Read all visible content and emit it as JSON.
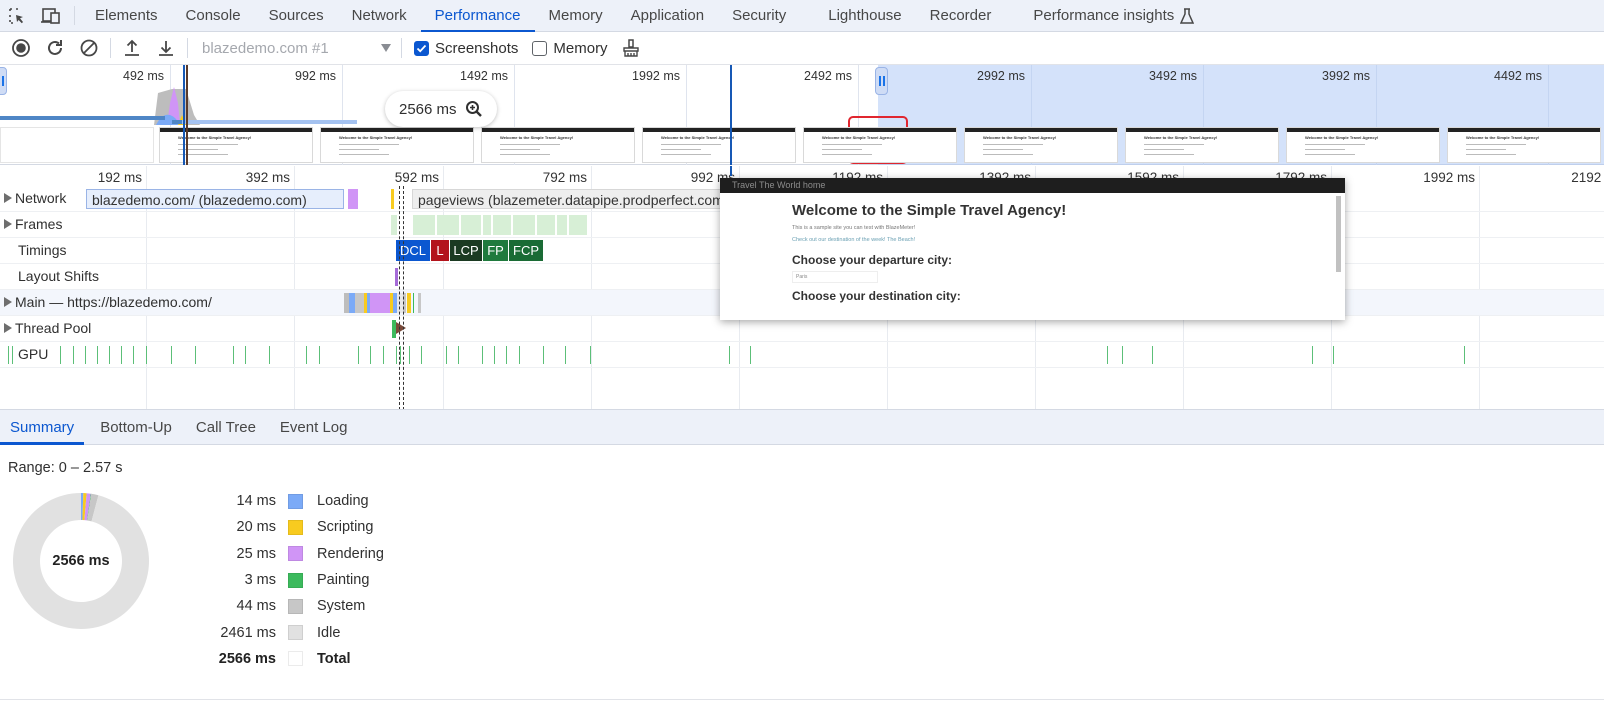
{
  "tabbar": {
    "tools": [
      "inspect-element-icon",
      "device-toolbar-icon"
    ],
    "tabs": [
      {
        "label": "Elements",
        "active": false
      },
      {
        "label": "Console",
        "active": false
      },
      {
        "label": "Sources",
        "active": false
      },
      {
        "label": "Network",
        "active": false
      },
      {
        "label": "Performance",
        "active": true
      },
      {
        "label": "Memory",
        "active": false
      },
      {
        "label": "Application",
        "active": false
      },
      {
        "label": "Security",
        "active": false
      },
      {
        "label": "Lighthouse",
        "active": false
      },
      {
        "label": "Recorder",
        "active": false
      },
      {
        "label": "Performance insights",
        "active": false,
        "icon": "flask-icon"
      }
    ]
  },
  "toolbar": {
    "record_icon": "record-icon",
    "reload_icon": "reload-record-icon",
    "clear_icon": "clear-icon",
    "upload_icon": "load-profile-icon",
    "download_icon": "save-profile-icon",
    "profile_select": "blazedemo.com #1",
    "screenshots_label": "Screenshots",
    "screenshots_checked": true,
    "memory_label": "Memory",
    "memory_checked": false,
    "gc_icon": "collect-garbage-icon"
  },
  "overview": {
    "ticks": [
      "492 ms",
      "992 ms",
      "1492 ms",
      "1992 ms",
      "2492 ms",
      "2992 ms",
      "3492 ms",
      "3992 ms",
      "4492 ms"
    ],
    "range_pill": "2566 ms",
    "range_pill_icon": "zoom-in-icon",
    "selection_end_ms": 2566
  },
  "flame": {
    "ticks": [
      "192 ms",
      "392 ms",
      "592 ms",
      "792 ms",
      "992 ms",
      "1192 ms",
      "1392 ms",
      "1592 ms",
      "1792 ms",
      "1992 ms",
      "2192 ms"
    ],
    "tracks": [
      {
        "name": "Network",
        "expandable": true
      },
      {
        "name": "Frames",
        "expandable": true
      },
      {
        "name": "Timings",
        "expandable": false
      },
      {
        "name": "Layout Shifts",
        "expandable": false
      },
      {
        "name": "Main — https://blazedemo.com/",
        "expandable": true
      },
      {
        "name": "Thread Pool",
        "expandable": true
      },
      {
        "name": "GPU",
        "expandable": false
      }
    ],
    "network_requests": [
      "blazedemo.com/ (blazedemo.com)",
      "pageviews (blazemeter.datapipe.prodperfect.com)"
    ],
    "timing_markers": [
      {
        "label": "DCL",
        "color": "#0b57d0"
      },
      {
        "label": "L",
        "color": "#b3141c"
      },
      {
        "label": "LCP",
        "color": "#1b3a22"
      },
      {
        "label": "FP",
        "color": "#1f7a3d"
      },
      {
        "label": "FCP",
        "color": "#1a6b35"
      }
    ]
  },
  "popover": {
    "nav": "Travel The World   home",
    "heading": "Welcome to the Simple Travel Agency!",
    "line1": "This is a sample site you can test with BlazeMeter!",
    "line2": "Check out our destination of the week! The Beach!",
    "departure": "Choose your departure city:",
    "departure_value": "Paris",
    "destination": "Choose your destination city:"
  },
  "bottom_tabs": [
    {
      "label": "Summary",
      "active": true
    },
    {
      "label": "Bottom-Up",
      "active": false
    },
    {
      "label": "Call Tree",
      "active": false
    },
    {
      "label": "Event Log",
      "active": false
    }
  ],
  "summary": {
    "range": "Range: 0 – 2.57 s",
    "total_center": "2566 ms",
    "items": [
      {
        "value": "14 ms",
        "ms": 14,
        "name": "Loading",
        "color": "#7baaf7"
      },
      {
        "value": "20 ms",
        "ms": 20,
        "name": "Scripting",
        "color": "#f8cb1f"
      },
      {
        "value": "25 ms",
        "ms": 25,
        "name": "Rendering",
        "color": "#d095f6"
      },
      {
        "value": "3 ms",
        "ms": 3,
        "name": "Painting",
        "color": "#3cba5d"
      },
      {
        "value": "44 ms",
        "ms": 44,
        "name": "System",
        "color": "#c7c7c7"
      },
      {
        "value": "2461 ms",
        "ms": 2461,
        "name": "Idle",
        "color": "#e1e1e1"
      }
    ],
    "total": {
      "value": "2566 ms",
      "name": "Total",
      "color": "#ffffff"
    }
  }
}
